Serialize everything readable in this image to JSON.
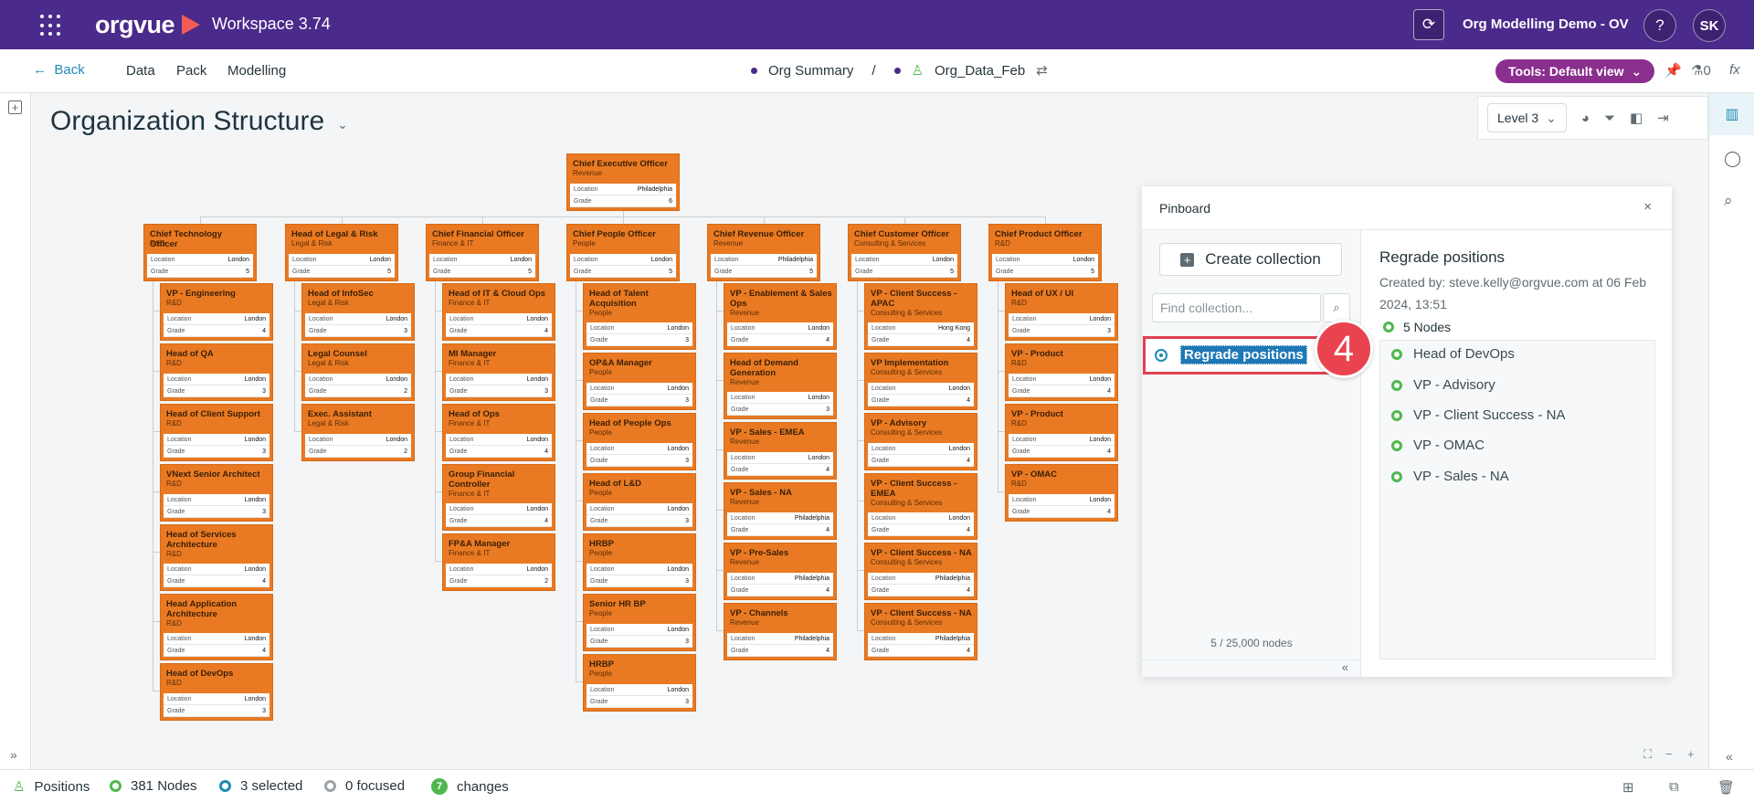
{
  "app": {
    "logo": "orgvue",
    "workspace": "Workspace  3.74",
    "dataset_title": "Org Modelling Demo - OV",
    "help_label": "?",
    "user_initials": "SK"
  },
  "nav": {
    "back_label": "Back",
    "items": [
      "Data",
      "Pack",
      "Modelling"
    ],
    "breadcrumb_summary": "Org Summary",
    "breadcrumb_sep": "/",
    "breadcrumb_dataset": "Org_Data_Feb",
    "tools_label": "Tools: Default view",
    "alerts_count": "0",
    "fx_label": "fx"
  },
  "canvas": {
    "title": "Organization Structure",
    "level_select": "Level 3"
  },
  "org_chart": {
    "ceo": {
      "title": "Chief Executive Officer",
      "dept": "Revenue",
      "location": "Philadelphia",
      "grade": "6"
    },
    "field_location": "Location",
    "field_grade": "Grade",
    "columns": [
      {
        "head": {
          "title": "Chief Technology Officer",
          "dept": "R&D",
          "location": "London",
          "grade": "5"
        },
        "reports": [
          {
            "title": "VP - Engineering",
            "dept": "R&D",
            "location": "London",
            "grade": "4"
          },
          {
            "title": "Head of QA",
            "dept": "R&D",
            "location": "London",
            "grade": "3"
          },
          {
            "title": "Head of Client Support",
            "dept": "R&D",
            "location": "London",
            "grade": "3"
          },
          {
            "title": "VNext Senior Architect",
            "dept": "R&D",
            "location": "London",
            "grade": "3"
          },
          {
            "title": "Head of Services Architecture",
            "dept": "R&D",
            "location": "London",
            "grade": "4"
          },
          {
            "title": "Head Application Architecture",
            "dept": "R&D",
            "location": "London",
            "grade": "4"
          },
          {
            "title": "Head of DevOps",
            "dept": "R&D",
            "location": "London",
            "grade": "3"
          }
        ]
      },
      {
        "head": {
          "title": "Head of Legal & Risk",
          "dept": "Legal & Risk",
          "location": "London",
          "grade": "5"
        },
        "reports": [
          {
            "title": "Head of InfoSec",
            "dept": "Legal & Risk",
            "location": "London",
            "grade": "3"
          },
          {
            "title": "Legal Counsel",
            "dept": "Legal & Risk",
            "location": "London",
            "grade": "2"
          },
          {
            "title": "Exec. Assistant",
            "dept": "Legal & Risk",
            "location": "London",
            "grade": "2"
          }
        ]
      },
      {
        "head": {
          "title": "Chief Financial Officer",
          "dept": "Finance & IT",
          "location": "London",
          "grade": "5"
        },
        "reports": [
          {
            "title": "Head of IT & Cloud Ops",
            "dept": "Finance & IT",
            "location": "London",
            "grade": "4"
          },
          {
            "title": "MI Manager",
            "dept": "Finance & IT",
            "location": "London",
            "grade": "3"
          },
          {
            "title": "Head of Ops",
            "dept": "Finance & IT",
            "location": "London",
            "grade": "4"
          },
          {
            "title": "Group Financial Controller",
            "dept": "Finance & IT",
            "location": "London",
            "grade": "4"
          },
          {
            "title": "FP&A Manager",
            "dept": "Finance & IT",
            "location": "London",
            "grade": "2"
          }
        ]
      },
      {
        "head": {
          "title": "Chief People Officer",
          "dept": "People",
          "location": "London",
          "grade": "5"
        },
        "reports": [
          {
            "title": "Head of Talent Acquisition",
            "dept": "People",
            "location": "London",
            "grade": "3"
          },
          {
            "title": "OP&A Manager",
            "dept": "People",
            "location": "London",
            "grade": "3"
          },
          {
            "title": "Head of People Ops",
            "dept": "People",
            "location": "London",
            "grade": "3"
          },
          {
            "title": "Head of L&D",
            "dept": "People",
            "location": "London",
            "grade": "3"
          },
          {
            "title": "HRBP",
            "dept": "People",
            "location": "London",
            "grade": "3"
          },
          {
            "title": "Senior HR BP",
            "dept": "People",
            "location": "London",
            "grade": "3"
          },
          {
            "title": "HRBP",
            "dept": "People",
            "location": "London",
            "grade": "3"
          }
        ]
      },
      {
        "head": {
          "title": "Chief Revenue Officer",
          "dept": "Revenue",
          "location": "Philadelphia",
          "grade": "5"
        },
        "reports": [
          {
            "title": "VP - Enablement & Sales Ops",
            "dept": "Revenue",
            "location": "London",
            "grade": "4"
          },
          {
            "title": "Head of Demand Generation",
            "dept": "Revenue",
            "location": "London",
            "grade": "3"
          },
          {
            "title": "VP - Sales - EMEA",
            "dept": "Revenue",
            "location": "London",
            "grade": "4"
          },
          {
            "title": "VP - Sales - NA",
            "dept": "Revenue",
            "location": "Philadelphia",
            "grade": "4"
          },
          {
            "title": "VP - Pre-Sales",
            "dept": "Revenue",
            "location": "Philadelphia",
            "grade": "4"
          },
          {
            "title": "VP - Channels",
            "dept": "Revenue",
            "location": "Philadelphia",
            "grade": "4"
          }
        ]
      },
      {
        "head": {
          "title": "Chief Customer Officer",
          "dept": "Consulting & Services",
          "location": "London",
          "grade": "5"
        },
        "reports": [
          {
            "title": "VP - Client Success - APAC",
            "dept": "Consulting & Services",
            "location": "Hong Kong",
            "grade": "4"
          },
          {
            "title": "VP Implementation",
            "dept": "Consulting & Services",
            "location": "London",
            "grade": "4"
          },
          {
            "title": "VP - Advisory",
            "dept": "Consulting & Services",
            "location": "London",
            "grade": "4"
          },
          {
            "title": "VP - Client Success - EMEA",
            "dept": "Consulting & Services",
            "location": "London",
            "grade": "4"
          },
          {
            "title": "VP - Client Success - NA",
            "dept": "Consulting & Services",
            "location": "Philadelphia",
            "grade": "4"
          },
          {
            "title": "VP - Client Success - NA",
            "dept": "Consulting & Services",
            "location": "Philadelphia",
            "grade": "4"
          }
        ]
      },
      {
        "head": {
          "title": "Chief Product Officer",
          "dept": "R&D",
          "location": "London",
          "grade": "5"
        },
        "reports": [
          {
            "title": "Head of UX / UI",
            "dept": "R&D",
            "location": "London",
            "grade": "3"
          },
          {
            "title": "VP - Product",
            "dept": "R&D",
            "location": "London",
            "grade": "4"
          },
          {
            "title": "VP - Product",
            "dept": "R&D",
            "location": "London",
            "grade": "4"
          },
          {
            "title": "VP - OMAC",
            "dept": "R&D",
            "location": "London",
            "grade": "4"
          }
        ]
      }
    ]
  },
  "pinboard": {
    "title": "Pinboard",
    "close": "×",
    "create_label": "Create collection",
    "find_placeholder": "Find collection...",
    "selected_collection": "Regrade positions",
    "step_badge": "4",
    "node_count": "5 / 25,000 nodes",
    "detail": {
      "title": "Regrade positions",
      "meta": "Created by: steve.kelly@orgvue.com at 06 Feb 2024, 13:51",
      "nodes_label": "5 Nodes",
      "nodes": [
        "Head of DevOps",
        "VP - Advisory",
        "VP - Client Success - NA",
        "VP - OMAC",
        "VP - Sales - NA"
      ]
    }
  },
  "status": {
    "positions": "Positions",
    "nodes": "381 Nodes",
    "selected": "3 selected",
    "focused": "0 focused",
    "changes_count": "7",
    "changes": "changes"
  },
  "colors": {
    "topbar": "#4a2a8a",
    "node_fill": "#e97a23",
    "tools_button": "#8b2f8f",
    "highlight": "#e04050",
    "node_ring": "#4fb84d"
  }
}
